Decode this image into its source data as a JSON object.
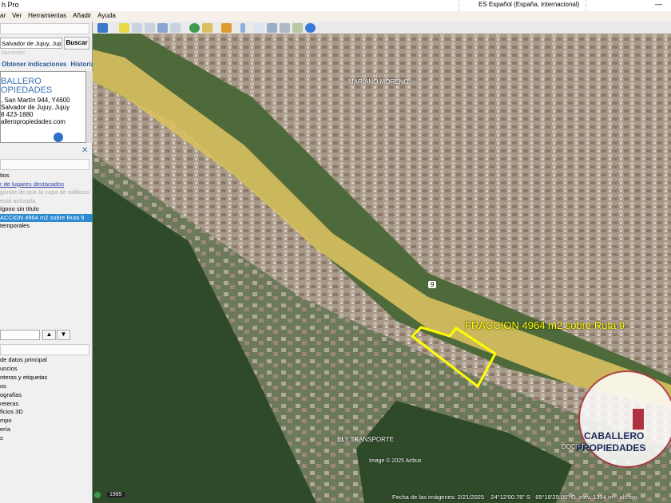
{
  "window": {
    "title": "h Pro",
    "language": "ES Español (España, internacional)",
    "minimize": "—"
  },
  "menu": [
    "ar",
    "Ver",
    "Herramientas",
    "Añadir",
    "Ayuda"
  ],
  "search": {
    "value": "Salvador de Jujuy, Jujuy",
    "button": "Buscar",
    "hint": "taurantes",
    "links": [
      "Obtener indicaciones",
      "Historial"
    ]
  },
  "card": {
    "name1": "BALLERO",
    "name2": "OPIEDADES",
    "address1": ", San Martín 944, Y4600",
    "address2": "Salvador de Jujuy, Jujuy",
    "phone": "8 423-1880",
    "web": "alleropropiedades.com"
  },
  "places": {
    "close": "✕",
    "items": [
      {
        "label": "tios",
        "style": "normal"
      },
      {
        "label": "r de lugares destacados",
        "style": "link"
      },
      {
        "label": "gúrate de que la capa de edificios",
        "style": "gray"
      },
      {
        "label": "está activada.",
        "style": "gray"
      },
      {
        "label": "ígono sin título",
        "style": "normal"
      },
      {
        "label": "ACCION 4964 m2 sobre Ruta 9",
        "style": "selected"
      },
      {
        "label": "temporales",
        "style": "normal"
      }
    ]
  },
  "layers": [
    "de datos principal",
    "uncios",
    "nteras y etiquetas",
    "os",
    "ografías",
    "reteras",
    "ficios 3D",
    "mpo",
    "ería",
    "s"
  ],
  "map": {
    "polygon_label": "FRACCION 4964 m2 sobre Ruta 9",
    "labels": [
      "MARIANO MORENO",
      "ELY TRANSPORTE",
      "DOCE DE",
      "Image © 2025 Airbus",
      "9"
    ],
    "historical_year": "1985",
    "status": "Fecha de las imágenes: 2/21/2025    24°12'00.78\" S   65°18'25.05\" O  elev. 1314 m    alt. ojo",
    "logo": {
      "line1": "CABALLERO",
      "line2": "PROPIEDADES"
    },
    "polygon_color": "#ffff00"
  }
}
